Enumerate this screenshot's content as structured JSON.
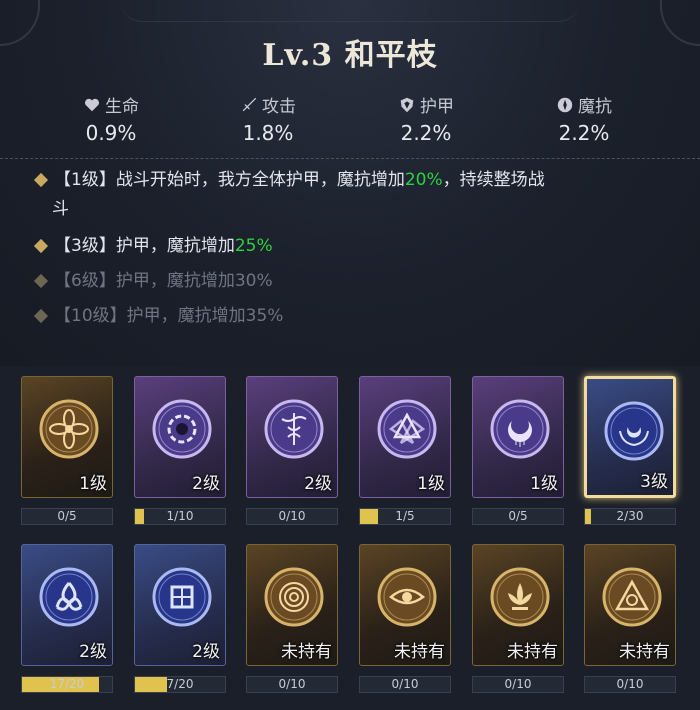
{
  "title": "Lv.3 和平枝",
  "stats": [
    {
      "label": "生命",
      "value": "0.9%",
      "icon": "heart-icon"
    },
    {
      "label": "攻击",
      "value": "1.8%",
      "icon": "sword-icon"
    },
    {
      "label": "护甲",
      "value": "2.2%",
      "icon": "shield-icon"
    },
    {
      "label": "魔抗",
      "value": "2.2%",
      "icon": "magic-resist-icon"
    }
  ],
  "skills": [
    {
      "prefix": "【1级】战斗开始时，我方全体护甲，魔抗增加",
      "highlight": "20%",
      "suffix": "，持续整场战",
      "line2": "斗",
      "active": true
    },
    {
      "prefix": "【3级】护甲，魔抗增加",
      "highlight": "25%",
      "suffix": "",
      "active": true
    },
    {
      "prefix": "【6级】护甲，魔抗增加30%",
      "highlight": "",
      "suffix": "",
      "active": false
    },
    {
      "prefix": "【10级】护甲，魔抗增加35%",
      "highlight": "",
      "suffix": "",
      "active": false
    }
  ],
  "cards": [
    {
      "name": "flower-emblem",
      "rarity": "gold",
      "level": "1级",
      "progress": "0/5",
      "fill": 0
    },
    {
      "name": "vortex-emblem",
      "rarity": "purple",
      "level": "2级",
      "progress": "1/10",
      "fill": 0.1
    },
    {
      "name": "caduceus-emblem",
      "rarity": "purple",
      "level": "2级",
      "progress": "0/10",
      "fill": 0
    },
    {
      "name": "valknut-emblem",
      "rarity": "purple",
      "level": "1级",
      "progress": "1/5",
      "fill": 0.2
    },
    {
      "name": "moon-dreamcatcher-emblem",
      "rarity": "purple",
      "level": "1级",
      "progress": "0/5",
      "fill": 0
    },
    {
      "name": "laurel-moon-emblem",
      "rarity": "blue",
      "level": "3级",
      "progress": "2/30",
      "fill": 0.067,
      "selected": true
    },
    {
      "name": "triquetra-emblem",
      "rarity": "blue",
      "level": "2级",
      "progress": "17/20",
      "fill": 0.85
    },
    {
      "name": "knot-emblem",
      "rarity": "blue",
      "level": "2级",
      "progress": "7/20",
      "fill": 0.35
    },
    {
      "name": "maze-emblem",
      "rarity": "gold",
      "level": "未持有",
      "progress": "0/10",
      "fill": 0
    },
    {
      "name": "eye-emblem",
      "rarity": "gold",
      "level": "未持有",
      "progress": "0/10",
      "fill": 0
    },
    {
      "name": "lotus-emblem",
      "rarity": "gold",
      "level": "未持有",
      "progress": "0/10",
      "fill": 0
    },
    {
      "name": "triangle-emblem",
      "rarity": "gold",
      "level": "未持有",
      "progress": "0/10",
      "fill": 0
    }
  ],
  "colors": {
    "highlight": "#2ed13e",
    "progress_fill": "#e0c34e",
    "selected_border": "#f1dc9c"
  }
}
